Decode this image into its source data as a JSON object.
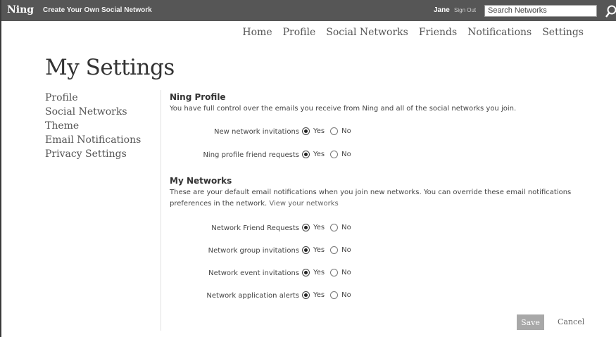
{
  "topbar": {
    "logo": "Ning",
    "create_link": "Create Your Own Social Network",
    "username": "Jane",
    "sign_out": "Sign Out",
    "search_value": "Search Networks"
  },
  "nav": {
    "items": [
      "Home",
      "Profile",
      "Social Networks",
      "Friends",
      "Notifications",
      "Settings"
    ]
  },
  "page_title": "My Settings",
  "sidebar": {
    "items": [
      "Profile",
      "Social Networks",
      "Theme",
      "Email Notifications",
      "Privacy Settings"
    ]
  },
  "ning_profile": {
    "heading": "Ning Profile",
    "description": "You have full control over the emails you receive from Ning and all of the social networks you join.",
    "options": [
      {
        "label": "New network invitations",
        "selected": "Yes"
      },
      {
        "label": "Ning profile friend requests",
        "selected": "Yes"
      }
    ]
  },
  "my_networks": {
    "heading": "My Networks",
    "description": "These are your default email notifications when you join new networks. You can override these email notifications preferences in the network.",
    "link": "View your networks",
    "options": [
      {
        "label": "Network Friend Requests",
        "selected": "Yes"
      },
      {
        "label": "Network group invitations",
        "selected": "Yes"
      },
      {
        "label": "Network event invitations",
        "selected": "Yes"
      },
      {
        "label": "Network application alerts",
        "selected": "Yes"
      }
    ]
  },
  "radio_labels": {
    "yes": "Yes",
    "no": "No"
  },
  "actions": {
    "save": "Save",
    "cancel": "Cancel"
  }
}
